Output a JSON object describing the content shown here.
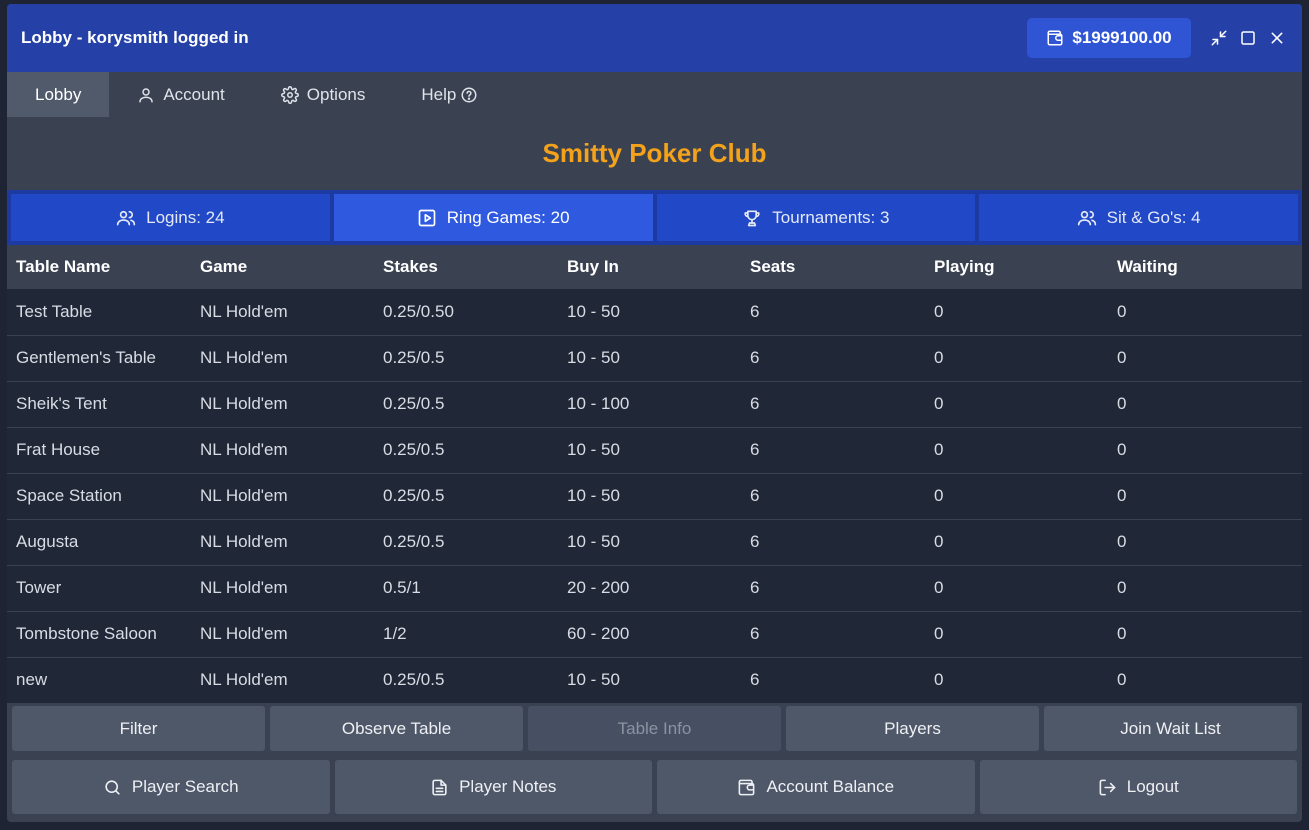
{
  "window": {
    "title": "Lobby - korysmith logged in",
    "balance": "$1999100.00"
  },
  "menu": {
    "items": [
      {
        "label": "Lobby",
        "icon": ""
      },
      {
        "label": "Account",
        "icon": "user-icon"
      },
      {
        "label": "Options",
        "icon": "gear-icon"
      },
      {
        "label": "Help",
        "icon": "help-circle-icon"
      }
    ]
  },
  "club_name": "Smitty Poker Club",
  "stats": [
    {
      "label": "Logins: 24",
      "icon": "users-icon"
    },
    {
      "label": "Ring Games: 20",
      "icon": "play-icon"
    },
    {
      "label": "Tournaments: 3",
      "icon": "trophy-icon"
    },
    {
      "label": "Sit & Go's: 4",
      "icon": "users-icon"
    }
  ],
  "table": {
    "headers": [
      "Table Name",
      "Game",
      "Stakes",
      "Buy In",
      "Seats",
      "Playing",
      "Waiting"
    ],
    "rows": [
      [
        "Test Table",
        "NL Hold'em",
        "0.25/0.50",
        "10 - 50",
        "6",
        "0",
        "0"
      ],
      [
        "Gentlemen's Table",
        "NL Hold'em",
        "0.25/0.5",
        "10 - 50",
        "6",
        "0",
        "0"
      ],
      [
        "Sheik's Tent",
        "NL Hold'em",
        "0.25/0.5",
        "10 - 100",
        "6",
        "0",
        "0"
      ],
      [
        "Frat House",
        "NL Hold'em",
        "0.25/0.5",
        "10 - 50",
        "6",
        "0",
        "0"
      ],
      [
        "Space Station",
        "NL Hold'em",
        "0.25/0.5",
        "10 - 50",
        "6",
        "0",
        "0"
      ],
      [
        "Augusta",
        "NL Hold'em",
        "0.25/0.5",
        "10 - 50",
        "6",
        "0",
        "0"
      ],
      [
        "Tower",
        "NL Hold'em",
        "0.5/1",
        "20 - 200",
        "6",
        "0",
        "0"
      ],
      [
        "Tombstone Saloon",
        "NL Hold'em",
        "1/2",
        "60 - 200",
        "6",
        "0",
        "0"
      ],
      [
        "new",
        "NL Hold'em",
        "0.25/0.5",
        "10 - 50",
        "6",
        "0",
        "0"
      ]
    ]
  },
  "actions_row1": [
    {
      "label": "Filter"
    },
    {
      "label": "Observe Table"
    },
    {
      "label": "Table Info"
    },
    {
      "label": "Players"
    },
    {
      "label": "Join Wait List"
    }
  ],
  "actions_row2": [
    {
      "label": "Player Search",
      "icon": "search-icon"
    },
    {
      "label": "Player Notes",
      "icon": "document-icon"
    },
    {
      "label": "Account Balance",
      "icon": "wallet-icon"
    },
    {
      "label": "Logout",
      "icon": "logout-icon"
    }
  ],
  "colors": {
    "titlebar": "#2541a8",
    "accent_title": "#f5a21b",
    "stat_bg": "#2148c7",
    "stat_active": "#2f5ae0"
  }
}
